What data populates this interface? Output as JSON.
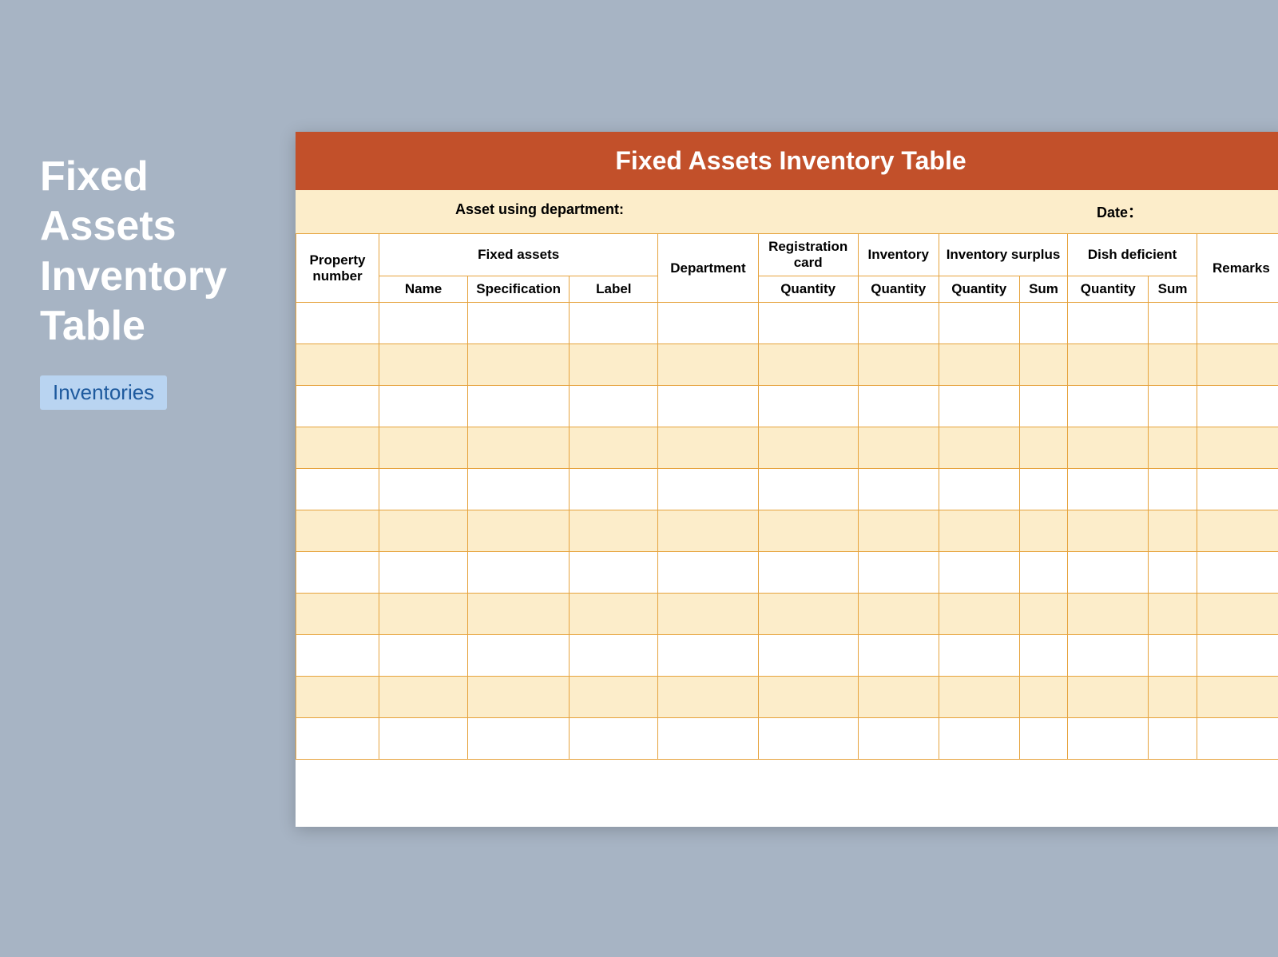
{
  "sidebar": {
    "title_line1": "Fixed",
    "title_line2": "Assets",
    "title_line3": "Inventory",
    "title_line4": "Table",
    "tag": "Inventories"
  },
  "sheet": {
    "title": "Fixed Assets Inventory Table",
    "meta": {
      "department_label": "Asset using department:",
      "date_label": "Date："
    },
    "headers": {
      "property_number": "Property number",
      "fixed_assets": "Fixed assets",
      "fixed_assets_sub": {
        "name": "Name",
        "specification": "Specification",
        "label": "Label"
      },
      "department": "Department",
      "registration_card": "Registration card",
      "registration_card_sub": "Quantity",
      "inventory": "Inventory",
      "inventory_sub": "Quantity",
      "inventory_surplus": "Inventory surplus",
      "inventory_surplus_sub": {
        "quantity": "Quantity",
        "sum": "Sum"
      },
      "dish_deficient": "Dish deficient",
      "dish_deficient_sub": {
        "quantity": "Quantity",
        "sum": "Sum"
      },
      "remarks": "Remarks"
    },
    "rows": [
      {},
      {},
      {},
      {},
      {},
      {},
      {},
      {},
      {},
      {},
      {}
    ]
  }
}
